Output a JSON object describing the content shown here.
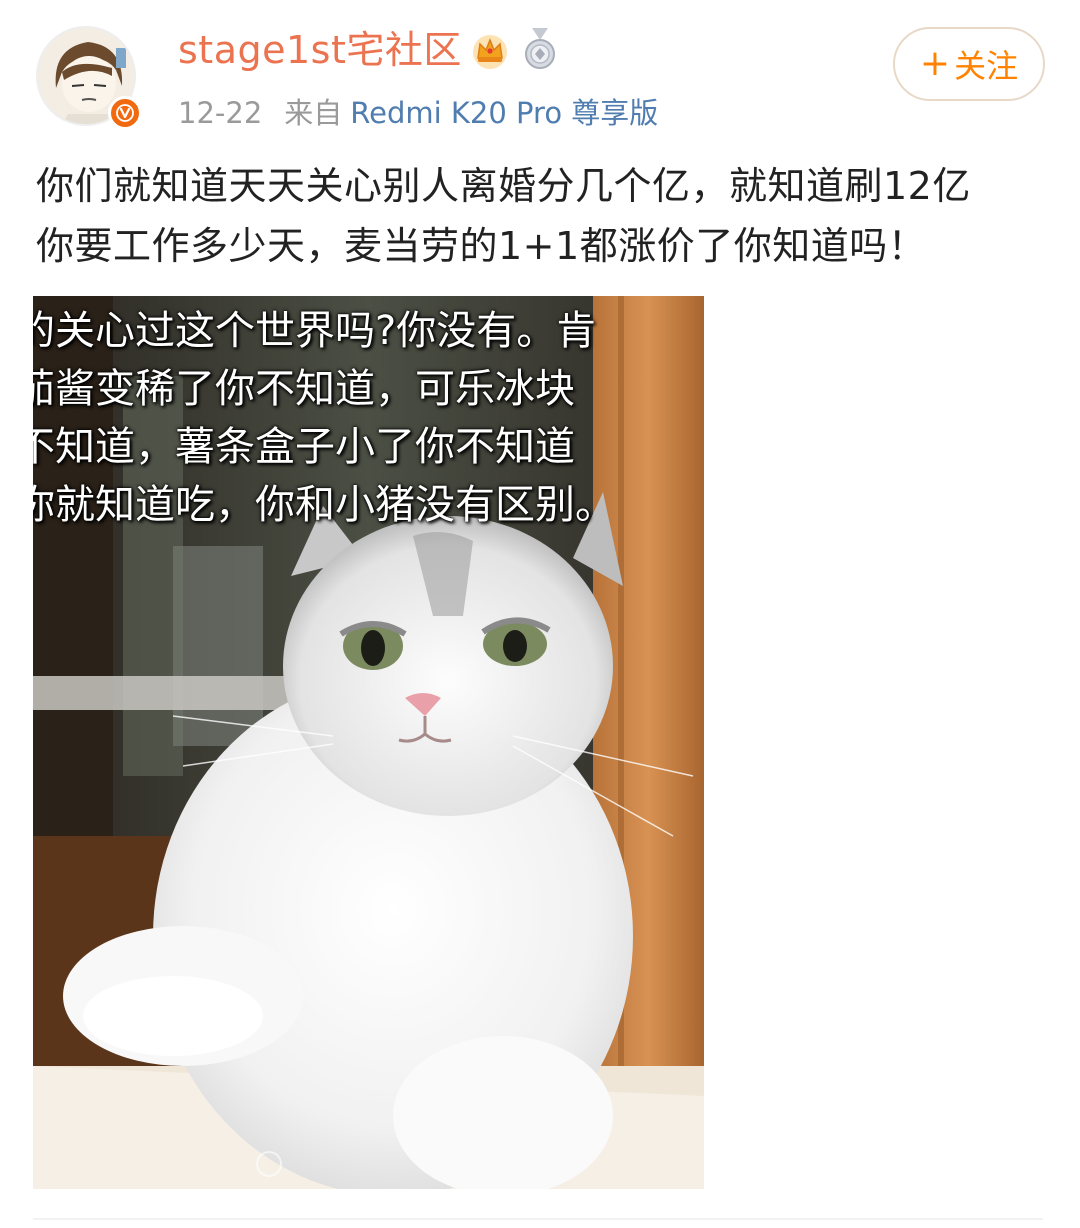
{
  "header": {
    "username": "stage1st宅社区",
    "date": "12-22",
    "source_prefix": "来自",
    "device": "Redmi K20 Pro 尊享版",
    "follow_label": "关注",
    "follow_plus": "+",
    "badges": [
      "crown-icon",
      "medal-icon"
    ],
    "verified_badge": "V"
  },
  "post": {
    "text_line1": "你们就知道天天关心别人离婚分几个亿，就知道刷12亿",
    "text_line2": "你要工作多少天，麦当劳的1+1都涨价了你知道吗！"
  },
  "image": {
    "caption_lines": [
      "的关心过这个世界吗?你没有。肯",
      "茄酱变稀了你不知道，可乐冰块",
      "不知道，薯条盒子小了你不知道",
      "你就知道吃，你和小猪没有区别。"
    ]
  },
  "colors": {
    "username": "#eb7350",
    "device_link": "#507daf",
    "follow": "#ff8200",
    "verified": "#f26a0f"
  }
}
